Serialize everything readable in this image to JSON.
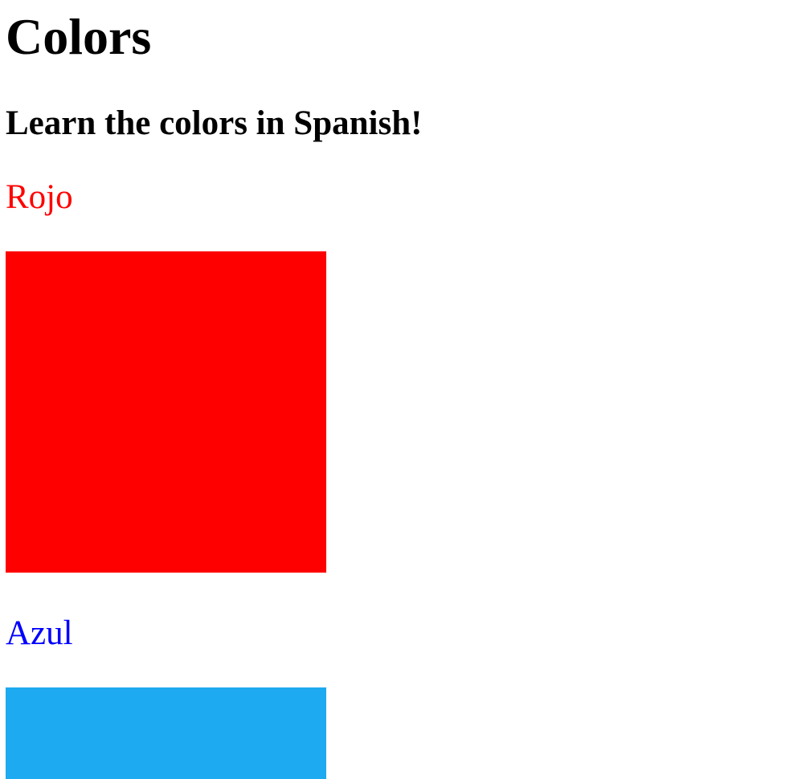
{
  "page": {
    "title": "Colors",
    "subtitle": "Learn the colors in Spanish!"
  },
  "colors": [
    {
      "name": "Rojo",
      "text_color": "#ff0000",
      "swatch_color": "#ff0000"
    },
    {
      "name": "Azul",
      "text_color": "#0000ff",
      "swatch_color": "#1eaaf0"
    }
  ]
}
